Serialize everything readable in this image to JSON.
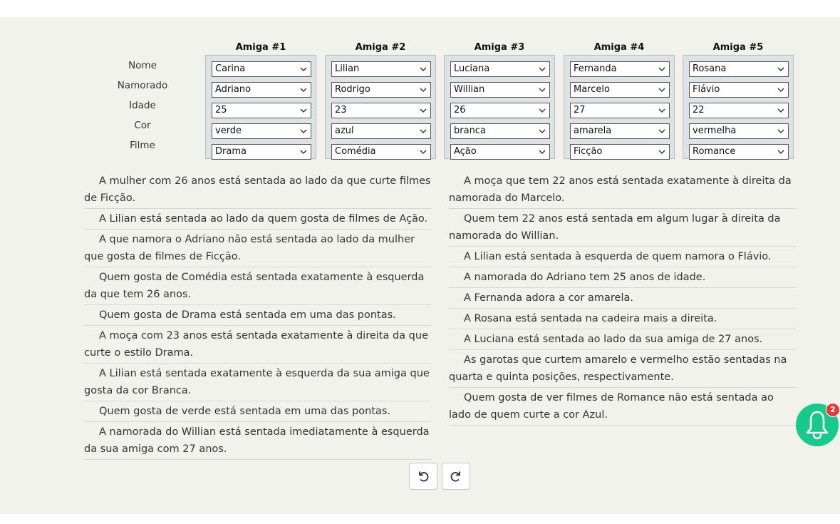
{
  "grid": {
    "row_labels": [
      "Nome",
      "Namorado",
      "Idade",
      "Cor",
      "Filme"
    ],
    "columns": [
      {
        "header": "Amiga #1",
        "values": [
          "Carina",
          "Adriano",
          "25",
          "verde",
          "Drama"
        ]
      },
      {
        "header": "Amiga #2",
        "values": [
          "Lilian",
          "Rodrigo",
          "23",
          "azul",
          "Comédia"
        ]
      },
      {
        "header": "Amiga #3",
        "values": [
          "Luciana",
          "Willian",
          "26",
          "branca",
          "Ação"
        ]
      },
      {
        "header": "Amiga #4",
        "values": [
          "Fernanda",
          "Marcelo",
          "27",
          "amarela",
          "Ficção"
        ]
      },
      {
        "header": "Amiga #5",
        "values": [
          "Rosana",
          "Flávio",
          "22",
          "vermelha",
          "Romance"
        ]
      }
    ]
  },
  "clues_left": [
    "A mulher com 26 anos está sentada ao lado da que curte filmes de Ficção.",
    "A Lilian está sentada ao lado da quem gosta de filmes de Ação.",
    "A que namora o Adriano não está sentada ao lado da mulher que gosta de filmes de Ficção.",
    "Quem gosta de Comédia está sentada exatamente à esquerda da que tem 26 anos.",
    "Quem gosta de Drama está sentada em uma das pontas.",
    "A moça com 23 anos está sentada exatamente à direita da que curte o estilo Drama.",
    "A Lilian está sentada exatamente à esquerda da sua amiga que gosta da cor Branca.",
    "Quem gosta de verde está sentada em uma das pontas.",
    "A namorada do Willian está sentada imediatamente à esquerda da sua amiga com 27 anos."
  ],
  "clues_right": [
    "A moça que tem 22 anos está sentada exatamente à direita da namorada do Marcelo.",
    "Quem tem 22 anos está sentada em algum lugar à direita da namorada do Willian.",
    "A Lilian está sentada à esquerda de quem namora o Flávio.",
    "A namorada do Adriano tem 25 anos de idade.",
    "A Fernanda adora a cor amarela.",
    "A Rosana está sentada na cadeira mais a direita.",
    "A Luciana está sentada ao lado da sua amiga de 27 anos.",
    "As garotas que curtem amarelo e vermelho estão sentadas na quarta e quinta posições, respectivamente.",
    "Quem gosta de ver filmes de Romance não está sentada ao lado de quem curte a cor Azul."
  ],
  "controls": {
    "undo_icon": "undo-icon",
    "redo_icon": "redo-icon"
  },
  "notification": {
    "icon": "bell-icon",
    "count": "2",
    "color": "#19c88c",
    "badge_color": "#e53935"
  }
}
